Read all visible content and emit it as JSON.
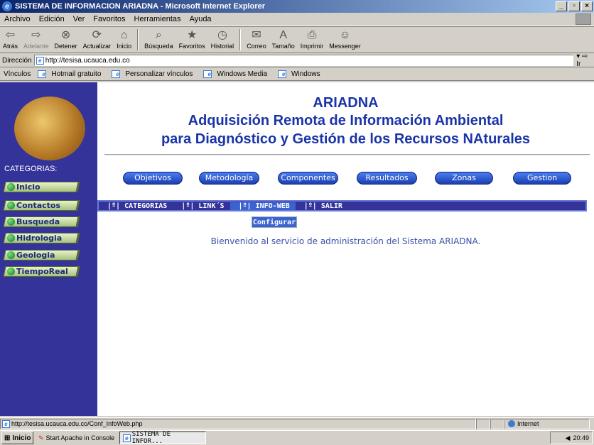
{
  "window": {
    "title": "SISTEMA DE INFORMACION ARIADNA - Microsoft Internet Explorer"
  },
  "menubar": [
    "Archivo",
    "Edición",
    "Ver",
    "Favoritos",
    "Herramientas",
    "Ayuda"
  ],
  "toolbar": {
    "back": "Atrás",
    "forward": "Adelante",
    "stop": "Detener",
    "refresh": "Actualizar",
    "home": "Inicio",
    "search": "Búsqueda",
    "favorites": "Favoritos",
    "history": "Historial",
    "mail": "Correo",
    "size": "Tamaño",
    "print": "Imprimir",
    "messenger": "Messenger"
  },
  "address": {
    "label": "Dirección",
    "url": "http://tesisa.ucauca.edu.co",
    "go": "Ir"
  },
  "links": {
    "label": "Vínculos",
    "items": [
      "Hotmail gratuito",
      "Personalizar vínculos",
      "Windows Media",
      "Windows"
    ]
  },
  "page": {
    "title1": "ARIADNA",
    "title2": "Adquisición Remota de Información Ambiental",
    "title3": "para Diagnóstico y Gestión de los Recursos NAturales",
    "categories_title": "CATEGORIAS:",
    "categories": [
      "Inicio",
      "Contactos",
      "Busqueda",
      "Hidrologia",
      "Geologia",
      "TiempoReal"
    ],
    "nav": [
      "Objetivos",
      "Metodología",
      "Componentes",
      "Resultados",
      "Zonas",
      "Gestion"
    ],
    "menu": [
      "|º| CATEGORIAS",
      "|º| LINK´S",
      "|º| INFO-WEB",
      "|º| SALIR"
    ],
    "submenu": "Configurar",
    "welcome": "Bienvenido al servicio de administración del Sistema ARIADNA."
  },
  "status": {
    "url": "http://tesisa.ucauca.edu.co/Conf_InfoWeb.php",
    "zone": "Internet"
  },
  "taskbar": {
    "start": "Inicio",
    "task1": "Start Apache in Console",
    "task2": "SISTEMA DE INFOR...",
    "time": "20:49"
  }
}
